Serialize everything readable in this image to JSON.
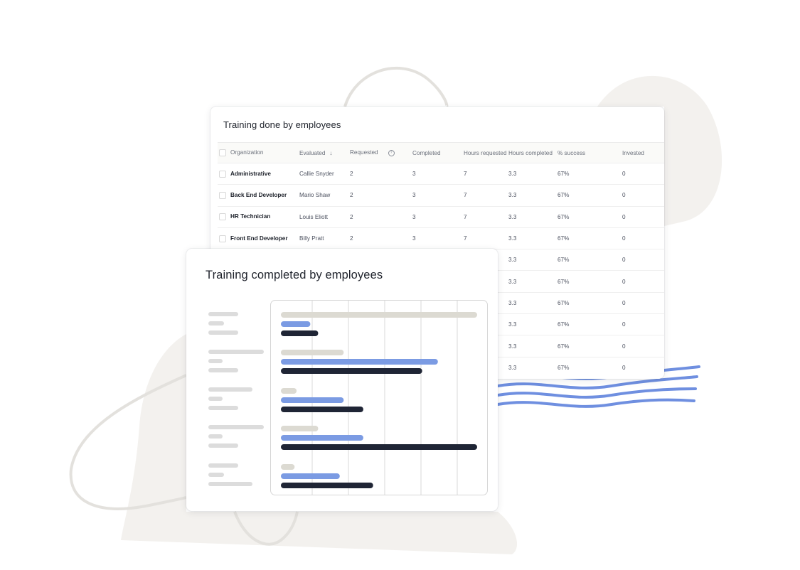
{
  "table": {
    "title": "Training done by employees",
    "columns": [
      {
        "label": "Organization"
      },
      {
        "label": "Evaluated",
        "icon": "arrow-down-icon"
      },
      {
        "label": "Requested",
        "icon": "help-circle-icon"
      },
      {
        "label": "Completed"
      },
      {
        "label": "Hours requested"
      },
      {
        "label": "Hours completed"
      },
      {
        "label": "% success"
      },
      {
        "label": "Invested"
      }
    ],
    "rows": [
      {
        "organization": "Administrative",
        "evaluated": "Callie Snyder",
        "requested": "2",
        "completed": "3",
        "hours_requested": "7",
        "hours_completed": "3.3",
        "success": "67%",
        "invested": "0"
      },
      {
        "organization": "Back End Developer",
        "evaluated": "Mario Shaw",
        "requested": "2",
        "completed": "3",
        "hours_requested": "7",
        "hours_completed": "3.3",
        "success": "67%",
        "invested": "0"
      },
      {
        "organization": "HR Technician",
        "evaluated": "Louis Eliott",
        "requested": "2",
        "completed": "3",
        "hours_requested": "7",
        "hours_completed": "3.3",
        "success": "67%",
        "invested": "0"
      },
      {
        "organization": "Front End Developer",
        "evaluated": "Billy Pratt",
        "requested": "2",
        "completed": "3",
        "hours_requested": "7",
        "hours_completed": "3.3",
        "success": "67%",
        "invested": "0"
      },
      {
        "organization": "",
        "evaluated": "",
        "requested": "",
        "completed": "",
        "hours_requested": "",
        "hours_completed": "3.3",
        "success": "67%",
        "invested": "0"
      },
      {
        "organization": "",
        "evaluated": "",
        "requested": "",
        "completed": "",
        "hours_requested": "",
        "hours_completed": "3.3",
        "success": "67%",
        "invested": "0"
      },
      {
        "organization": "",
        "evaluated": "",
        "requested": "",
        "completed": "",
        "hours_requested": "",
        "hours_completed": "3.3",
        "success": "67%",
        "invested": "0"
      },
      {
        "organization": "",
        "evaluated": "",
        "requested": "",
        "completed": "",
        "hours_requested": "",
        "hours_completed": "3.3",
        "success": "67%",
        "invested": "0"
      },
      {
        "organization": "",
        "evaluated": "",
        "requested": "",
        "completed": "",
        "hours_requested": "",
        "hours_completed": "3.3",
        "success": "67%",
        "invested": "0"
      },
      {
        "organization": "",
        "evaluated": "",
        "requested": "",
        "completed": "",
        "hours_requested": "",
        "hours_completed": "3.3",
        "success": "67%",
        "invested": "0"
      }
    ]
  },
  "chart_card": {
    "title": "Training completed by employees"
  },
  "chart_data": {
    "type": "bar",
    "orientation": "horizontal",
    "title": "Training completed by employees",
    "categories": [
      "",
      "",
      "",
      "",
      ""
    ],
    "xlim": [
      0,
      100
    ],
    "grid": true,
    "series": [
      {
        "color": "#dcdad2",
        "values": [
          100,
          32,
          8,
          19,
          7
        ]
      },
      {
        "color": "#7b9be3",
        "values": [
          15,
          80,
          32,
          42,
          30
        ]
      },
      {
        "color": "#1f2535",
        "values": [
          19,
          72,
          42,
          100,
          47
        ]
      }
    ]
  },
  "colors": {
    "blob": "#f3f1ee",
    "loop": "#e3e1dd",
    "waves": "#6f8fe0",
    "accent_blue": "#7b9be3",
    "navy": "#1f2535",
    "beige": "#dcdad2"
  }
}
